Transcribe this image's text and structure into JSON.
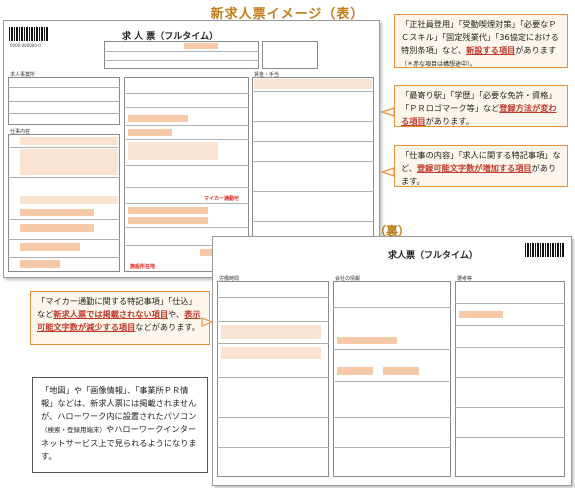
{
  "titles": {
    "front": "新求人票イメージ（表）",
    "back": "（裏）"
  },
  "front_form": {
    "heading": "求 人 票（フルタイム）",
    "labels": [
      "求人事業所",
      "仕事内容",
      "就業場所",
      "労働時間",
      "賃金・手当"
    ],
    "code": "0000-000000-0",
    "red_notes": [
      "マイカー通勤可",
      "施設所在地"
    ]
  },
  "back_form": {
    "heading": "求人票（フルタイム）",
    "labels": [
      "労働時間",
      "会社の情報",
      "選考等"
    ]
  },
  "callouts": {
    "c1": {
      "pre": "「正社員登用」「受動喫煙対策」「必要なＰＣスキル」「固定残業代」「36協定における特別条項」など、",
      "u": "新設する項目",
      "post": "があります",
      "small": "（＊赤な項目は構想途中）。"
    },
    "c2": {
      "pre": "「最寄り駅」「学歴」「必要な免許・資格」「ＰＲロゴマーク等」など",
      "u": "登録方法が変わる項目",
      "post": "があります。"
    },
    "c3": {
      "pre": "「仕事の内容」「求人に関する特記事項」など、",
      "u": "登録可能文字数が増加する項目",
      "post": "があります。"
    },
    "c4": {
      "pre": "「マイカー通勤に関する特記事項」「仕込」など",
      "u1": "新求人票では掲載されない項目",
      "mid": "や、",
      "u2": "表示可能文字数が減少する項目",
      "post": "などがあります。"
    }
  },
  "note": {
    "pre": "「地図」や「画像情報」、「事業所ＰＲ情報」などは、新求人票には掲載されませんが、ハローワーク内に設置されたパソコン",
    "small": "（検索・登録用端末）",
    "post": "やハローワークインターネットサービス上で見られるようになります。"
  }
}
